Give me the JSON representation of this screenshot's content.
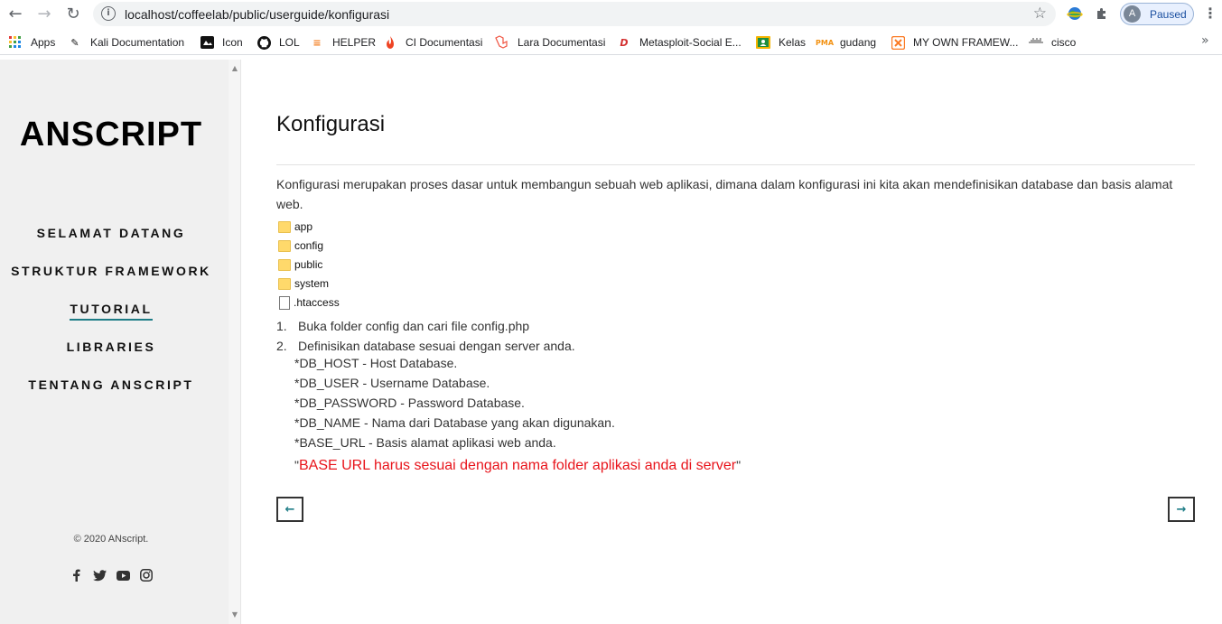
{
  "browser": {
    "url": "localhost/coffeelab/public/userguide/konfigurasi",
    "profile_initial": "A",
    "profile_label": "Paused"
  },
  "bookmarks": [
    {
      "label": "Apps",
      "icon": "apps-grid-icon"
    },
    {
      "label": "Kali Documentation",
      "icon": "kali-icon"
    },
    {
      "label": "Icon",
      "icon": "icon-site-icon"
    },
    {
      "label": "LOL",
      "icon": "github-icon"
    },
    {
      "label": "HELPER",
      "icon": "stackoverflow-icon"
    },
    {
      "label": "CI Documentasi",
      "icon": "codeigniter-icon"
    },
    {
      "label": "Lara Documentasi",
      "icon": "laravel-icon"
    },
    {
      "label": "Metasploit-Social E...",
      "icon": "metasploit-icon"
    },
    {
      "label": "Kelas",
      "icon": "classroom-icon"
    },
    {
      "label": "gudang",
      "icon": "phpmyadmin-icon"
    },
    {
      "label": "MY OWN FRAMEW...",
      "icon": "xampp-icon"
    },
    {
      "label": "cisco",
      "icon": "cisco-icon"
    }
  ],
  "sidebar": {
    "brand": "ANSCRIPT",
    "nav": [
      {
        "label": "SELAMAT DATANG",
        "active": false
      },
      {
        "label": "STRUKTUR FRAMEWORK",
        "active": false
      },
      {
        "label": "TUTORIAL",
        "active": true
      },
      {
        "label": "LIBRARIES",
        "active": false
      },
      {
        "label": "TENTANG ANSCRIPT",
        "active": false
      }
    ],
    "copyright": "© 2020 ANscript.",
    "social": [
      "facebook-icon",
      "twitter-icon",
      "youtube-icon",
      "instagram-icon"
    ]
  },
  "content": {
    "title": "Konfigurasi",
    "intro": "Konfigurasi merupakan proses dasar untuk membangun sebuah web aplikasi, dimana dalam konfigurasi ini kita akan mendefinisikan database dan basis alamat web.",
    "tree": [
      {
        "name": "app",
        "type": "folder"
      },
      {
        "name": "config",
        "type": "folder"
      },
      {
        "name": "public",
        "type": "folder"
      },
      {
        "name": "system",
        "type": "folder"
      },
      {
        "name": ".htaccess",
        "type": "file"
      }
    ],
    "steps": [
      {
        "num": "1.",
        "text": "Buka folder config dan cari file config.php"
      },
      {
        "num": "2.",
        "text": "Definisikan database sesuai dengan server anda."
      }
    ],
    "details": [
      "*DB_HOST - Host Database.",
      "*DB_USER - Username Database.",
      "*DB_PASSWORD - Password Database.",
      "*DB_NAME - Nama dari Database yang akan digunakan.",
      "*BASE_URL - Basis alamat aplikasi web anda."
    ],
    "warning_open": "\"",
    "warning": "BASE URL harus sesuai dengan nama folder aplikasi anda di server",
    "warning_close": "\"",
    "prev_label": "←",
    "next_label": "→"
  }
}
